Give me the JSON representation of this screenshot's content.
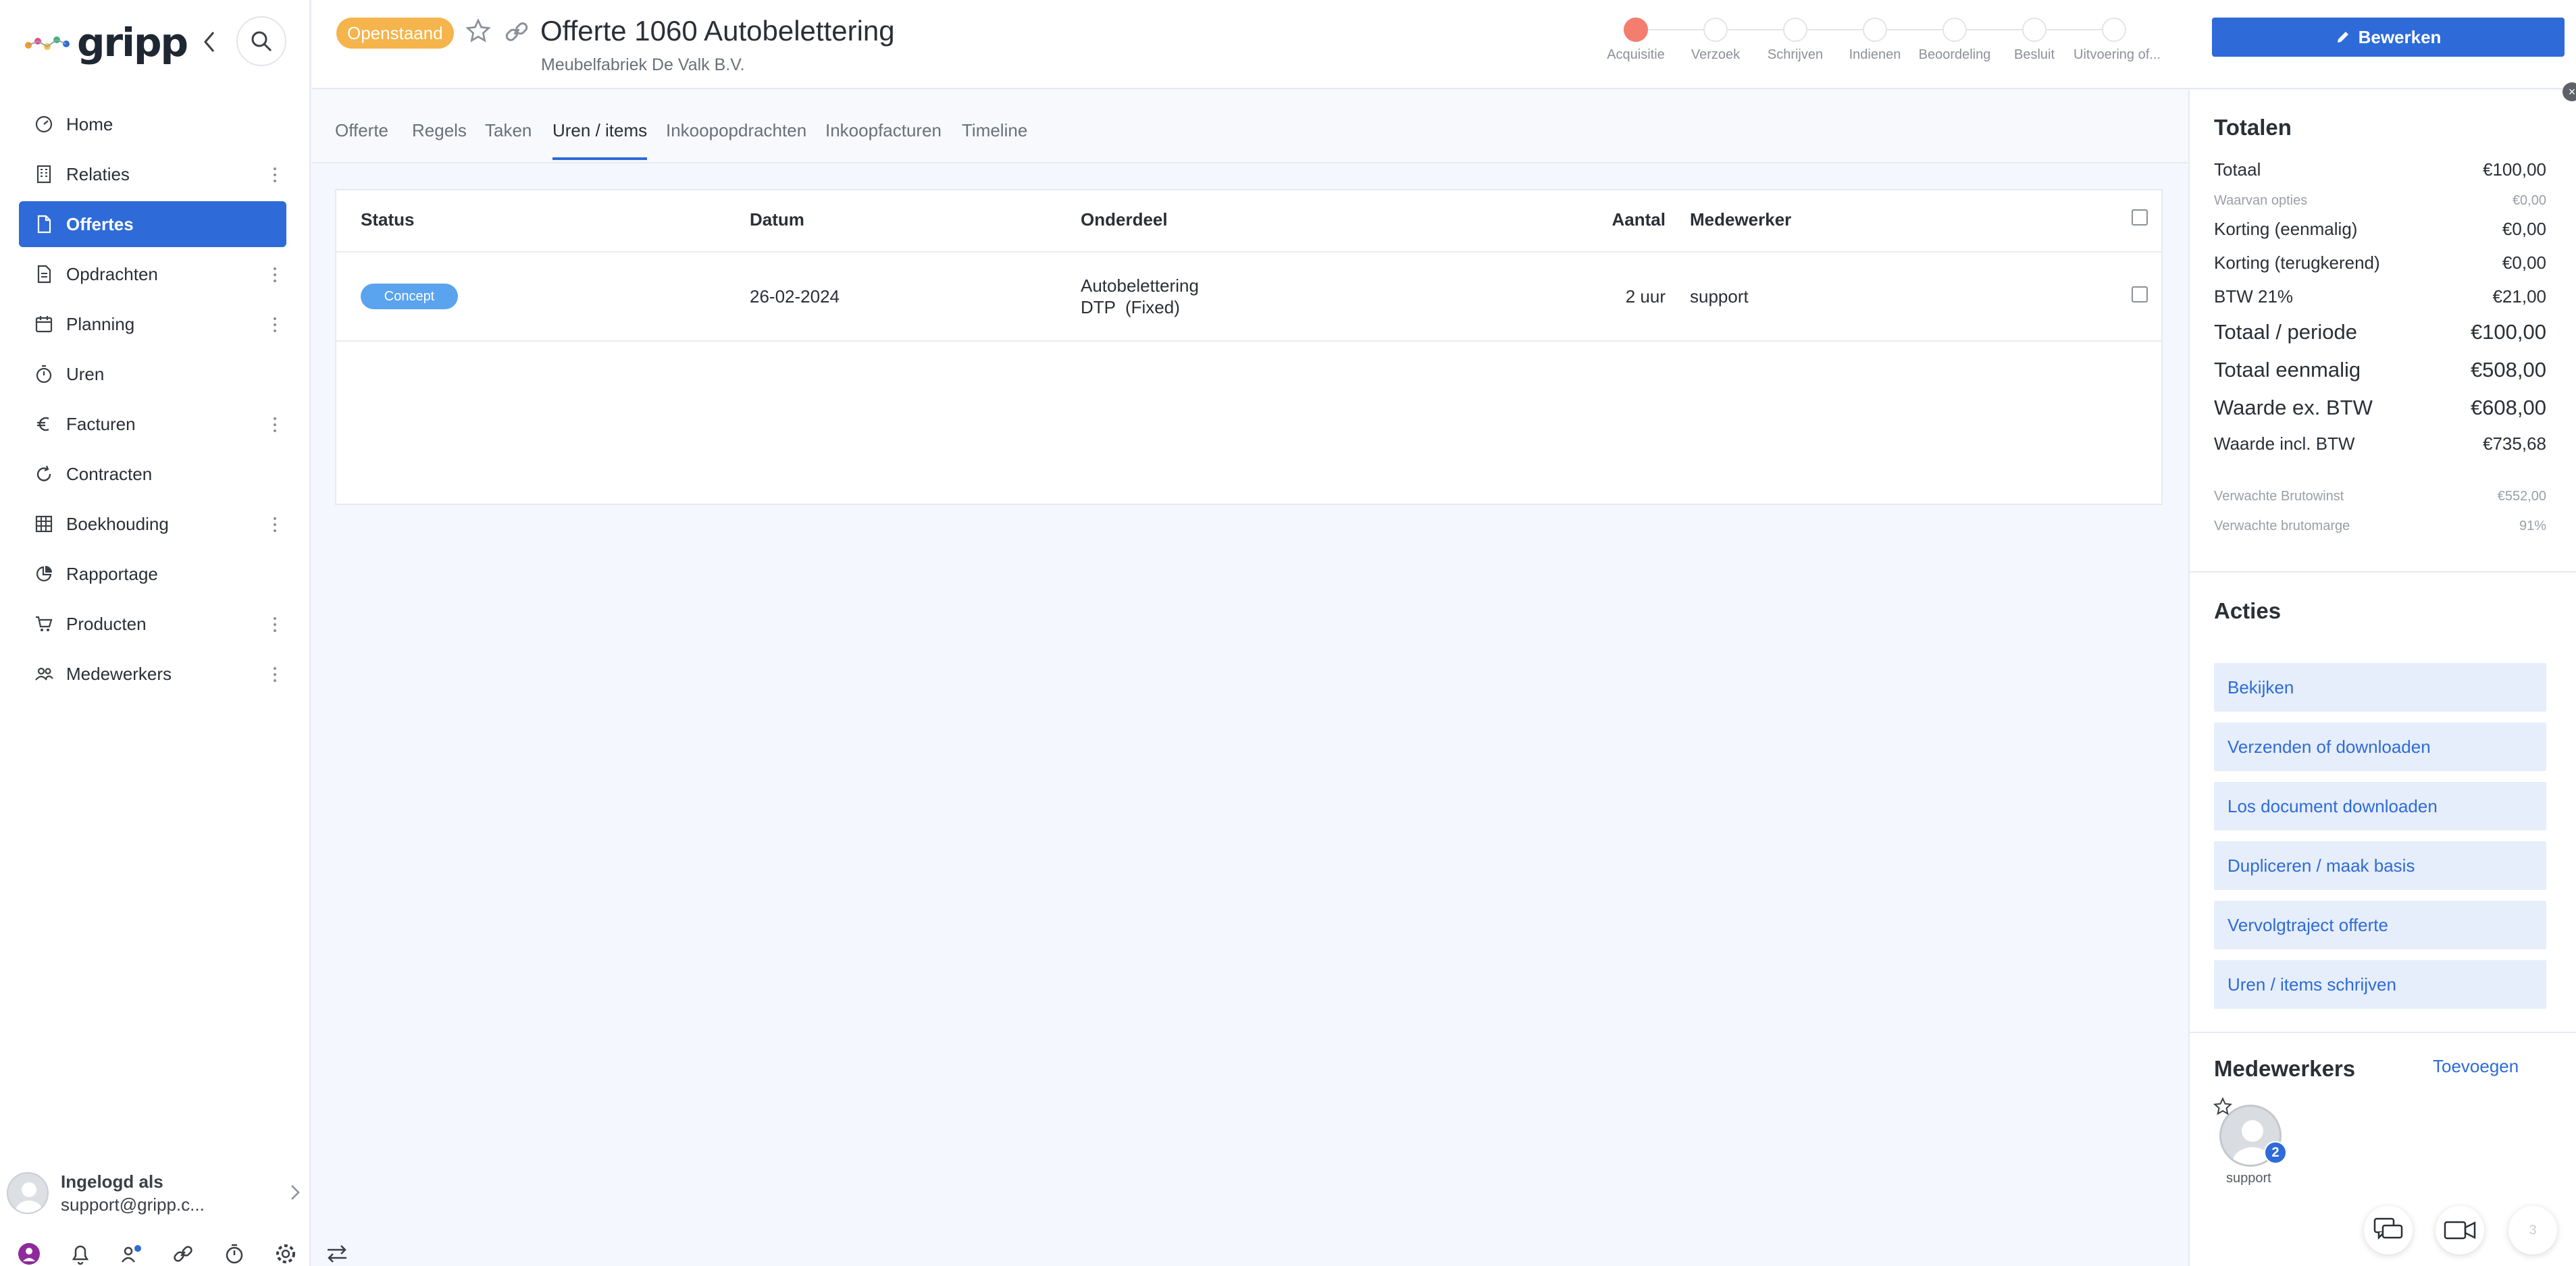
{
  "app": {
    "logo_text": "gripp"
  },
  "sidebar": {
    "items": [
      {
        "label": "Home",
        "icon": "dashboard-icon",
        "menu": false,
        "active": false
      },
      {
        "label": "Relaties",
        "icon": "building-icon",
        "menu": true,
        "active": false
      },
      {
        "label": "Offertes",
        "icon": "document-icon",
        "menu": false,
        "active": true
      },
      {
        "label": "Opdrachten",
        "icon": "document-lines-icon",
        "menu": true,
        "active": false
      },
      {
        "label": "Planning",
        "icon": "calendar-icon",
        "menu": true,
        "active": false
      },
      {
        "label": "Uren",
        "icon": "stopwatch-icon",
        "menu": false,
        "active": false
      },
      {
        "label": "Facturen",
        "icon": "euro-icon",
        "menu": true,
        "active": false
      },
      {
        "label": "Contracten",
        "icon": "refresh-icon",
        "menu": false,
        "active": false
      },
      {
        "label": "Boekhouding",
        "icon": "ledger-grid-icon",
        "menu": true,
        "active": false
      },
      {
        "label": "Rapportage",
        "icon": "pie-chart-icon",
        "menu": false,
        "active": false
      },
      {
        "label": "Producten",
        "icon": "cart-icon",
        "menu": true,
        "active": false
      },
      {
        "label": "Medewerkers",
        "icon": "users-icon",
        "menu": true,
        "active": false
      }
    ],
    "user": {
      "title": "Ingelogd als",
      "email": "support@gripp.c..."
    }
  },
  "header": {
    "status": "Openstaand",
    "title": "Offerte 1060 Autobelettering",
    "subtitle": "Meubelfabriek De Valk B.V.",
    "edit_label": "Bewerken",
    "steps": [
      "Acquisitie",
      "Verzoek",
      "Schrijven",
      "Indienen",
      "Beoordeling",
      "Besluit",
      "Uitvoering of..."
    ],
    "active_step": 0
  },
  "tabs": [
    "Offerte",
    "Regels",
    "Taken",
    "Uren / items",
    "Inkoopopdrachten",
    "Inkoopfacturen",
    "Timeline"
  ],
  "active_tab": 3,
  "table": {
    "headers": {
      "status": "Status",
      "datum": "Datum",
      "onderdeel": "Onderdeel",
      "aantal": "Aantal",
      "medewerker": "Medewerker"
    },
    "rows": [
      {
        "status": "Concept",
        "datum": "26-02-2024",
        "onderdeel_1": "Autobelettering",
        "onderdeel_2": "DTP  (Fixed)",
        "aantal": "2 uur",
        "medewerker": "support"
      }
    ]
  },
  "totals": {
    "heading": "Totalen",
    "rows": [
      {
        "label": "Totaal",
        "value": "€100,00",
        "size": "sm"
      },
      {
        "label": "Waarvan opties",
        "value": "€0,00",
        "size": "xs"
      },
      {
        "label": "Korting (eenmalig)",
        "value": "€0,00",
        "size": "sm"
      },
      {
        "label": "Korting (terugkerend)",
        "value": "€0,00",
        "size": "sm"
      },
      {
        "label": "BTW 21%",
        "value": "€21,00",
        "size": "sm"
      },
      {
        "label": "Totaal / periode",
        "value": "€100,00",
        "size": "lg"
      },
      {
        "label": "Totaal eenmalig",
        "value": "€508,00",
        "size": "lg"
      },
      {
        "label": "Waarde ex. BTW",
        "value": "€608,00",
        "size": "lg"
      },
      {
        "label": "Waarde incl. BTW",
        "value": "€735,68",
        "size": "sm"
      },
      {
        "label": "Verwachte Brutowinst",
        "value": "€552,00",
        "size": "xs"
      },
      {
        "label": "Verwachte brutomarge",
        "value": "91%",
        "size": "xs"
      }
    ]
  },
  "actions": {
    "heading": "Acties",
    "items": [
      "Bekijken",
      "Verzenden of downloaden",
      "Los document downloaden",
      "Dupliceren / maak basis",
      "Vervolgtraject offerte",
      "Uren / items schrijven"
    ]
  },
  "employees": {
    "heading": "Medewerkers",
    "add_label": "Toevoegen",
    "name": "support",
    "badge": "2"
  },
  "floating": {
    "third_label": "3"
  },
  "colors": {
    "primary": "#2e6bd8",
    "status_pending": "#f5b44c",
    "step_active": "#f37e70",
    "concept": "#5aa3ee"
  }
}
